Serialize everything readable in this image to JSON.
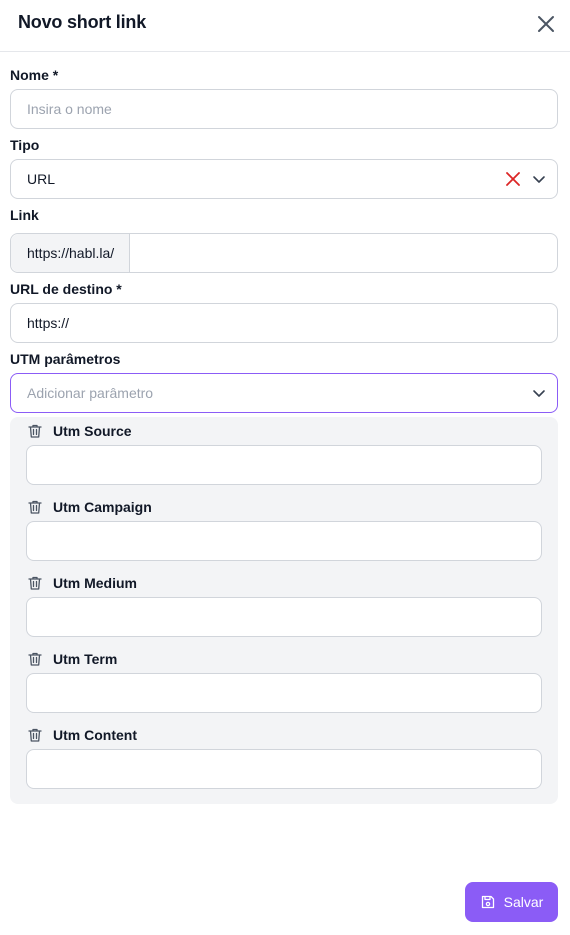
{
  "header": {
    "title": "Novo short link"
  },
  "form": {
    "nome": {
      "label": "Nome *",
      "placeholder": "Insira o nome",
      "value": ""
    },
    "tipo": {
      "label": "Tipo",
      "value": "URL"
    },
    "link": {
      "label": "Link",
      "prefix": "https://habl.la/",
      "value": ""
    },
    "destino": {
      "label": "URL de destino *",
      "value": "https://"
    },
    "utm": {
      "label": "UTM parâmetros",
      "placeholder": "Adicionar parâmetro"
    }
  },
  "utm_params": [
    {
      "label": "Utm Source",
      "value": ""
    },
    {
      "label": "Utm Campaign",
      "value": ""
    },
    {
      "label": "Utm Medium",
      "value": ""
    },
    {
      "label": "Utm Term",
      "value": ""
    },
    {
      "label": "Utm Content",
      "value": ""
    }
  ],
  "actions": {
    "save_label": "Salvar"
  },
  "colors": {
    "accent": "#8b5cf6",
    "danger": "#dc2626",
    "panel": "#f3f4f6",
    "border": "#d1d5db"
  },
  "icons": {
    "close": "close-icon",
    "clear": "clear-icon",
    "dropdown": "chevron-down-icon",
    "trash": "trash-icon",
    "save": "save-icon"
  }
}
